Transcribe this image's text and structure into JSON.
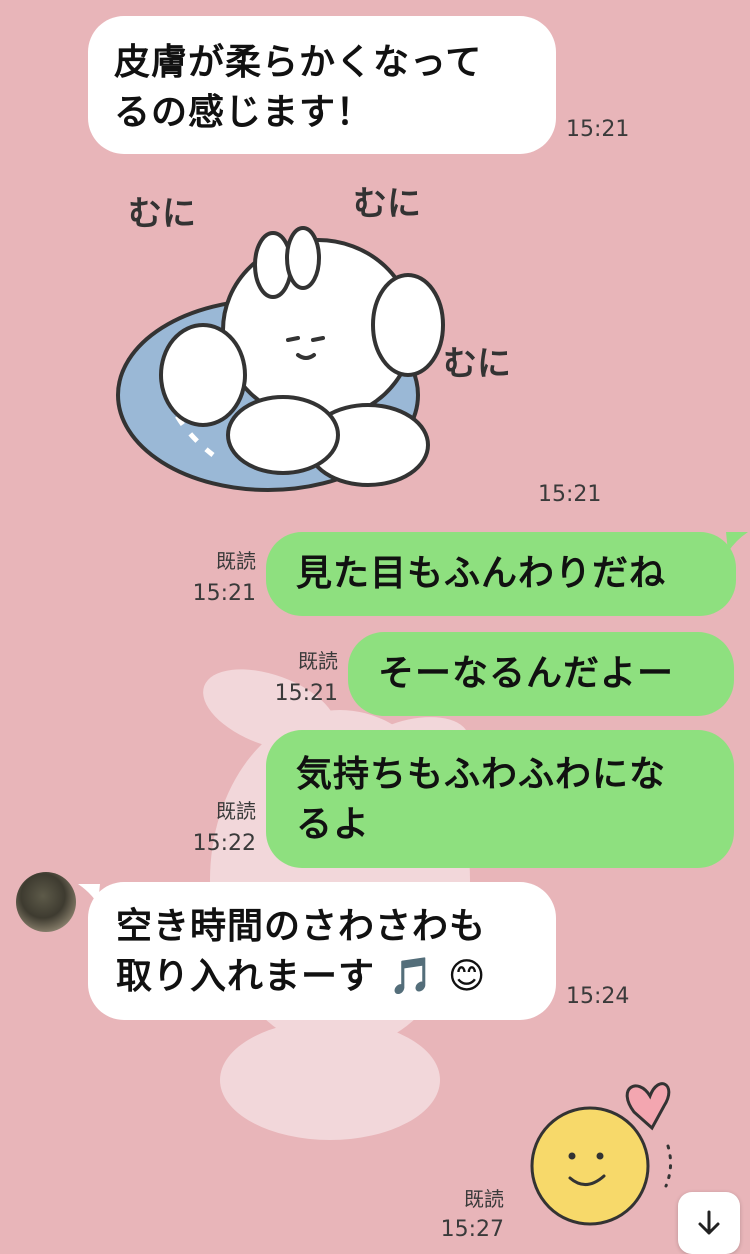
{
  "messages": [
    {
      "text": "皮膚が柔らかくなってるの感じます！",
      "line1": "皮膚が柔らかくなって",
      "line2": "るの感じます！",
      "time": "15:21",
      "side": "in"
    },
    {
      "sticker": "bunny-squish",
      "sticker_text": [
        "むに",
        "むに",
        "むに"
      ],
      "time": "15:21",
      "side": "in"
    },
    {
      "text": "見た目もふんわりだね",
      "time": "15:21",
      "read": "既読",
      "side": "out"
    },
    {
      "text": "そーなるんだよー",
      "time": "15:21",
      "read": "既読",
      "side": "out"
    },
    {
      "text": "気持ちもふわふわになるよ",
      "line1": "気持ちもふわふわにな",
      "line2": "るよ",
      "time": "15:22",
      "read": "既読",
      "side": "out"
    },
    {
      "text": "空き時間のさわさわも取り入れまーす🎵😊",
      "line1": "空き時間のさわさわも",
      "line2": "取り入れまーす",
      "emoji": "🎵 😊",
      "time": "15:24",
      "side": "in"
    },
    {
      "sticker": "smiley-heart",
      "time": "15:27",
      "read": "既読",
      "side": "out"
    }
  ],
  "icons": {
    "scroll_down": "arrow-down-icon",
    "avatar": "contact-avatar"
  },
  "colors": {
    "background": "#e8b5b9",
    "incoming_bubble": "#ffffff",
    "outgoing_bubble": "#8ee07f"
  }
}
